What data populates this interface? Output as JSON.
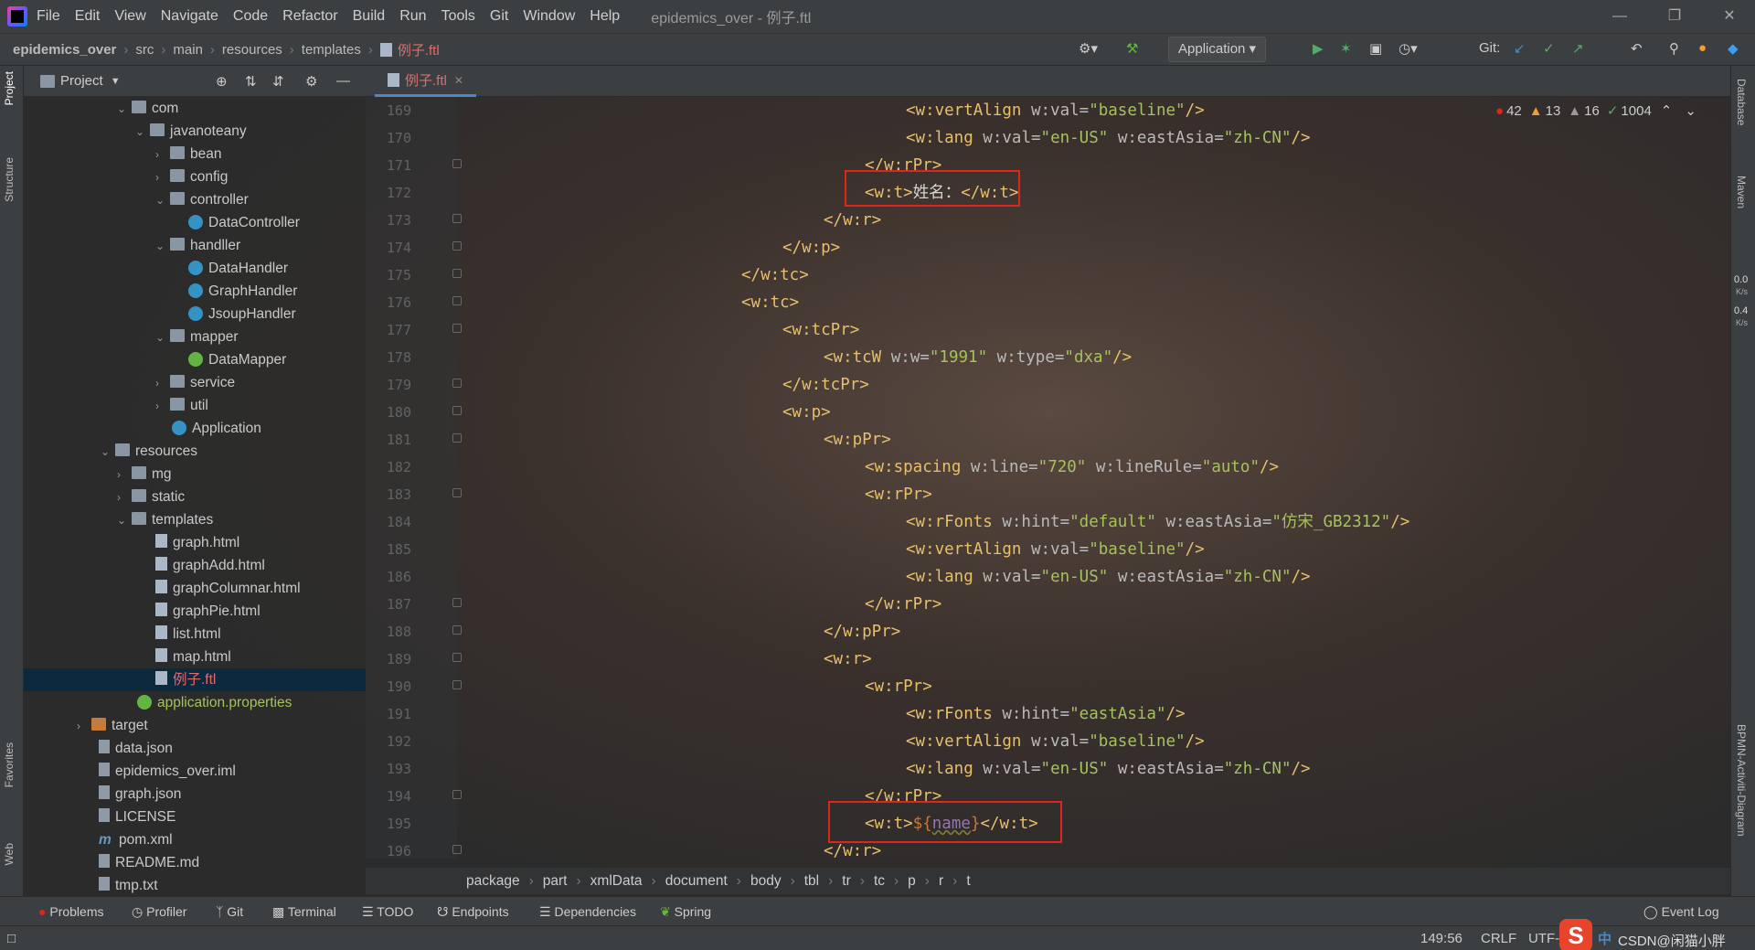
{
  "menu": {
    "items": [
      "File",
      "Edit",
      "View",
      "Navigate",
      "Code",
      "Refactor",
      "Build",
      "Run",
      "Tools",
      "Git",
      "Window",
      "Help"
    ],
    "window_title": "epidemics_over - 例子.ftl"
  },
  "navbar": {
    "crumbs": [
      "epidemics_over",
      "src",
      "main",
      "resources",
      "templates",
      "例子.ftl"
    ],
    "run_config": "Application",
    "git_label": "Git:"
  },
  "leftstrip": {
    "project": "Project",
    "structure": "Structure",
    "favorites": "Favorites",
    "web": "Web"
  },
  "project_panel": {
    "title": "Project"
  },
  "tree": [
    {
      "label": "com"
    },
    {
      "label": "javanoteany"
    },
    {
      "label": "bean"
    },
    {
      "label": "config"
    },
    {
      "label": "controller"
    },
    {
      "label": "DataController"
    },
    {
      "label": "handller"
    },
    {
      "label": "DataHandler"
    },
    {
      "label": "GraphHandler"
    },
    {
      "label": "JsoupHandler"
    },
    {
      "label": "mapper"
    },
    {
      "label": "DataMapper"
    },
    {
      "label": "service"
    },
    {
      "label": "util"
    },
    {
      "label": "Application"
    },
    {
      "label": "resources"
    },
    {
      "label": "mg"
    },
    {
      "label": "static"
    },
    {
      "label": "templates"
    },
    {
      "label": "graph.html"
    },
    {
      "label": "graphAdd.html"
    },
    {
      "label": "graphColumnar.html"
    },
    {
      "label": "graphPie.html"
    },
    {
      "label": "list.html"
    },
    {
      "label": "map.html"
    },
    {
      "label": "例子.ftl"
    },
    {
      "label": "application.properties"
    },
    {
      "label": "target"
    },
    {
      "label": "data.json"
    },
    {
      "label": "epidemics_over.iml"
    },
    {
      "label": "graph.json"
    },
    {
      "label": "LICENSE"
    },
    {
      "label": "pom.xml"
    },
    {
      "label": "README.md"
    },
    {
      "label": "tmp.txt"
    }
  ],
  "editor": {
    "tab_label": "例子.ftl",
    "inspections": {
      "errors": "42",
      "warnings": "13",
      "weak": "16",
      "typos": "1004"
    },
    "line_numbers": [
      "169",
      "170",
      "171",
      "172",
      "173",
      "174",
      "175",
      "176",
      "177",
      "178",
      "179",
      "180",
      "181",
      "182",
      "183",
      "184",
      "185",
      "186",
      "187",
      "188",
      "189",
      "190",
      "191",
      "192",
      "193",
      "194",
      "195",
      "196"
    ],
    "lines": [
      "<w:vertAlign w:val=\"baseline\"/>",
      "<w:lang w:val=\"en-US\" w:eastAsia=\"zh-CN\"/>",
      "</w:rPr>",
      "<w:t>姓名：</w:t>",
      "</w:r>",
      "</w:p>",
      "</w:tc>",
      "<w:tc>",
      "<w:tcPr>",
      "<w:tcW w:w=\"1991\" w:type=\"dxa\"/>",
      "</w:tcPr>",
      "<w:p>",
      "<w:pPr>",
      "<w:spacing w:line=\"720\" w:lineRule=\"auto\"/>",
      "<w:rPr>",
      "<w:rFonts w:hint=\"default\" w:eastAsia=\"仿宋_GB2312\"/>",
      "<w:vertAlign w:val=\"baseline\"/>",
      "<w:lang w:val=\"en-US\" w:eastAsia=\"zh-CN\"/>",
      "</w:rPr>",
      "</w:pPr>",
      "<w:r>",
      "<w:rPr>",
      "<w:rFonts w:hint=\"eastAsia\"/>",
      "<w:vertAlign w:val=\"baseline\"/>",
      "<w:lang w:val=\"en-US\" w:eastAsia=\"zh-CN\"/>",
      "</w:rPr>",
      "<w:t>${name}</w:t>",
      "</w:r>"
    ]
  },
  "breadcrumb": [
    "package",
    "part",
    "xmlData",
    "document",
    "body",
    "tbl",
    "tr",
    "tc",
    "p",
    "r",
    "t"
  ],
  "rightstrip": {
    "database": "Database",
    "maven": "Maven",
    "bpmn": "BPMN-Activiti-Diagram",
    "net_up": "0.0",
    "net_down": "0.4",
    "net_unit": "K/s"
  },
  "tooltabs": [
    "Problems",
    "Profiler",
    "Git",
    "Terminal",
    "TODO",
    "Endpoints",
    "Dependencies",
    "Spring"
  ],
  "event_log": "Event Log",
  "status": {
    "position": "149:56",
    "line_sep": "CRLF",
    "encoding": "UTF-",
    "ime": "中",
    "watermark": "CSDN@闲猫小胖"
  },
  "colors": {
    "accent": "#4a88c7",
    "error": "#e0261b",
    "tag": "#e8bf6a",
    "attr_value": "#a5c25c"
  }
}
